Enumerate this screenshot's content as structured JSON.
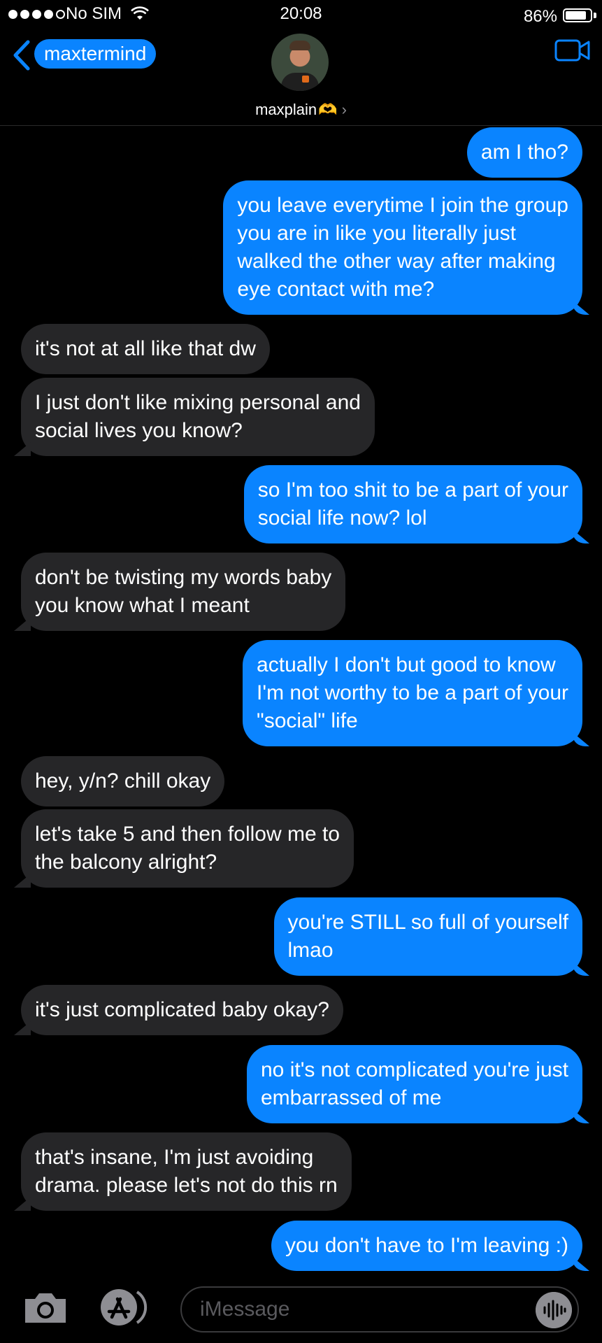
{
  "status_bar": {
    "carrier": "No SIM",
    "time": "20:08",
    "battery_percent": "86%",
    "signal_bars_filled": 4,
    "signal_bars_total": 5
  },
  "header": {
    "back_label": "maxtermind",
    "contact_name": "maxplain",
    "contact_emoji": "🫶",
    "chevron": "›"
  },
  "messages": [
    {
      "side": "sent",
      "text": "am I tho?"
    },
    {
      "side": "sent",
      "text": "you leave everytime I join the group\nyou are in like you literally just\nwalked the other way after making\neye contact with me?"
    },
    {
      "side": "recv",
      "text": "it's not at all like that dw"
    },
    {
      "side": "recv",
      "text": "I just don't like mixing personal and\nsocial lives you know?"
    },
    {
      "side": "sent",
      "text": "so I'm too shit to be a part of your\nsocial life now? lol"
    },
    {
      "side": "recv",
      "text": "don't be twisting my words baby\nyou know what I meant"
    },
    {
      "side": "sent",
      "text": "actually I don't but good to know\nI'm not worthy to be a part of your\n\"social\" life"
    },
    {
      "side": "recv",
      "text": "hey, y/n? chill okay"
    },
    {
      "side": "recv",
      "text": "let's take 5 and then follow me to\nthe balcony alright?"
    },
    {
      "side": "sent",
      "text": "you're STILL so full of yourself\nlmao"
    },
    {
      "side": "recv",
      "text": "it's just complicated baby okay?"
    },
    {
      "side": "sent",
      "text": "no it's not complicated you're just\nembarrassed of me"
    },
    {
      "side": "recv",
      "text": "that's insane, I'm just avoiding\ndrama. please let's not do this rn"
    },
    {
      "side": "sent",
      "text": "you don't have to I'm leaving :)"
    }
  ],
  "input": {
    "placeholder": "iMessage"
  },
  "colors": {
    "sent_bubble": "#0a84ff",
    "received_bubble": "#262628",
    "background": "#000000"
  },
  "icons": {
    "back": "chevron-left-icon",
    "video": "video-camera-icon",
    "camera": "camera-icon",
    "apps": "app-store-icon",
    "audio": "audio-waveform-icon",
    "wifi": "wifi-icon",
    "battery": "battery-icon"
  }
}
